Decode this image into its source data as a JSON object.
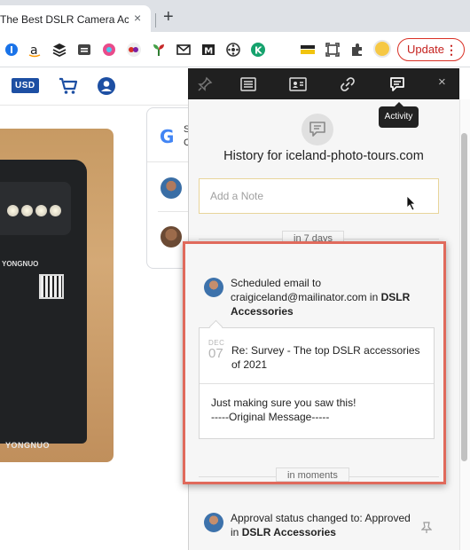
{
  "browser": {
    "tab_title": "The Best DSLR Camera Accesso",
    "tab_close": "×",
    "new_tab": "+",
    "update_label": "Update",
    "update_menu": "⋮",
    "extensions": [
      "1password-icon",
      "amazon-icon",
      "buffer-icon",
      "tab-manager-icon",
      "color-picker-icon",
      "dots-icon",
      "plant-icon",
      "mailtrack-icon",
      "gmail-m-icon",
      "film-icon",
      "grammarly-icon",
      "highlighter-icon",
      "screenshot-icon",
      "puzzle-icon"
    ]
  },
  "site": {
    "currency": "USD",
    "brand_text_1": "YONGNUO",
    "brand_text_2": "YONGNUO",
    "review_line1": "S",
    "review_line2": "C"
  },
  "panel": {
    "toolbar_icons": [
      "pin-icon",
      "list-icon",
      "contact-card-icon",
      "link-icon",
      "activity-icon"
    ],
    "close": "×",
    "tooltip": "Activity",
    "history_title": "History for iceland-photo-tours.com",
    "note_placeholder": "Add a Note",
    "sep1_label": "in 7 days",
    "sep2_label": "in moments",
    "activity1": {
      "line1": "Scheduled email to",
      "line2": "craigiceland@mailinator.com in",
      "group": "DSLR",
      "group2": "Accessories"
    },
    "email": {
      "month": "DEC",
      "day": "07",
      "subject": "Re: Survey - The top DSLR accessories of 2021",
      "body1": "Just making sure you saw this!",
      "body2": "-----Original Message-----"
    },
    "activity2": {
      "line1": "Approval status changed to: Approved",
      "prefix": "in",
      "group": "DSLR Accessories"
    }
  },
  "colors": {
    "highlight_border": "#e06a5c",
    "panel_bar": "#202020",
    "update_red": "#d93025",
    "usd_badge": "#1d4fa3"
  }
}
